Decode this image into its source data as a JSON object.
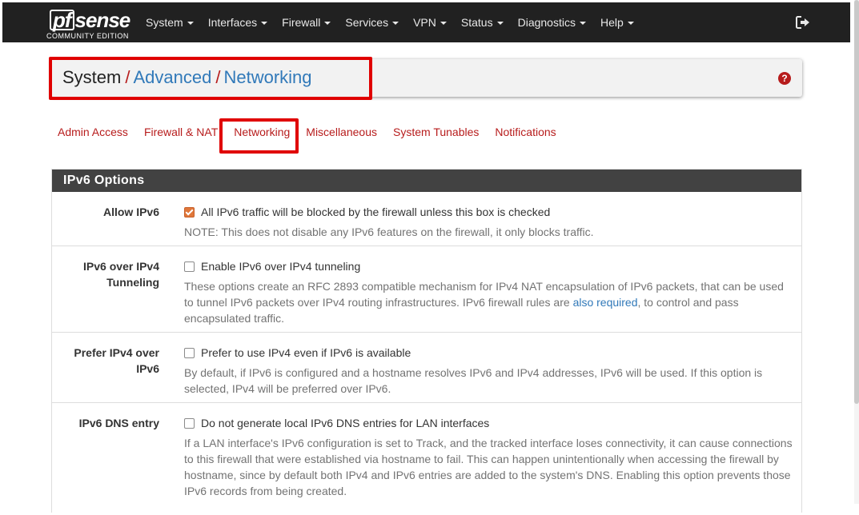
{
  "brand": {
    "logo_pf": "pf",
    "logo_rest": "sense",
    "edition": "COMMUNITY EDITION"
  },
  "nav": {
    "items": [
      {
        "label": "System"
      },
      {
        "label": "Interfaces"
      },
      {
        "label": "Firewall"
      },
      {
        "label": "Services"
      },
      {
        "label": "VPN"
      },
      {
        "label": "Status"
      },
      {
        "label": "Diagnostics"
      },
      {
        "label": "Help"
      }
    ],
    "logout_icon": "sign-out-icon"
  },
  "breadcrumb": {
    "root": "System",
    "separator": "/",
    "level1": "Advanced",
    "level2": "Networking",
    "help_icon": "question-circle-icon",
    "help_glyph": "?"
  },
  "tabs": [
    {
      "label": "Admin Access"
    },
    {
      "label": "Firewall & NAT"
    },
    {
      "label": "Networking",
      "active": true
    },
    {
      "label": "Miscellaneous"
    },
    {
      "label": "System Tunables"
    },
    {
      "label": "Notifications"
    }
  ],
  "panel": {
    "heading": "IPv6 Options",
    "rows": [
      {
        "label": "Allow IPv6",
        "checked": true,
        "checkbox_text": "All IPv6 traffic will be blocked by the firewall unless this box is checked",
        "help": "NOTE: This does not disable any IPv6 features on the firewall, it only blocks traffic."
      },
      {
        "label_line1": "IPv6 over IPv4",
        "label_line2": "Tunneling",
        "checked": false,
        "checkbox_text": "Enable IPv6 over IPv4 tunneling",
        "help_before_link": "These options create an RFC 2893 compatible mechanism for IPv4 NAT encapsulation of IPv6 packets, that can be used to tunnel IPv6 packets over IPv4 routing infrastructures. IPv6 firewall rules are ",
        "help_link": "also required",
        "help_after_link": ", to control and pass encapsulated traffic."
      },
      {
        "label_line1": "Prefer IPv4 over",
        "label_line2": "IPv6",
        "checked": false,
        "checkbox_text": "Prefer to use IPv4 even if IPv6 is available",
        "help": "By default, if IPv6 is configured and a hostname resolves IPv6 and IPv4 addresses, IPv6 will be used. If this option is selected, IPv4 will be preferred over IPv6."
      },
      {
        "label": "IPv6 DNS entry",
        "checked": false,
        "checkbox_text": "Do not generate local IPv6 DNS entries for LAN interfaces",
        "help": "If a LAN interface's IPv6 configuration is set to Track, and the tracked interface loses connectivity, it can cause connections to this firewall that were established via hostname to fail. This can happen unintentionally when accessing the firewall by hostname, since by default both IPv4 and IPv6 entries are added to the system's DNS. Enabling this option prevents those IPv6 records from being created."
      }
    ]
  },
  "colors": {
    "navbar": "#212121",
    "accent_red": "#b71c1c",
    "link_blue": "#3179b9",
    "checkbox_checked": "#e0773a",
    "annotation_red": "#e00000"
  }
}
